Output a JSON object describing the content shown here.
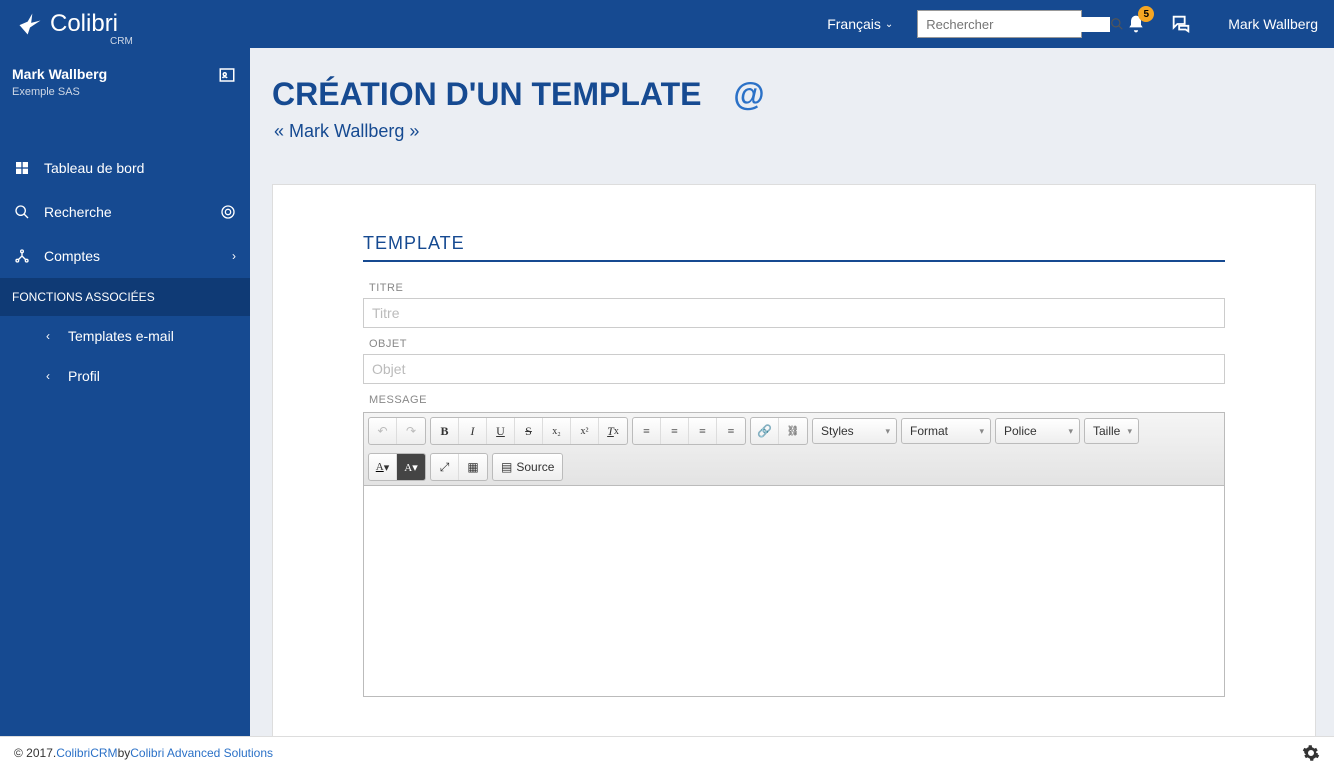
{
  "header": {
    "brand": "Colibri",
    "brand_sub": "CRM",
    "language": "Français",
    "search_placeholder": "Rechercher",
    "badge_count": "5",
    "user_name": "Mark Wallberg"
  },
  "sidebar": {
    "user_name": "Mark Wallberg",
    "user_company": "Exemple SAS",
    "items": [
      {
        "label": "Tableau de bord"
      },
      {
        "label": "Recherche"
      },
      {
        "label": "Comptes"
      }
    ],
    "associated_header": "FONCTIONS ASSOCIÉES",
    "sub_items": [
      {
        "label": "Templates e-mail"
      },
      {
        "label": "Profil"
      }
    ]
  },
  "page": {
    "title": "CRÉATION D'UN TEMPLATE",
    "at": "@",
    "breadcrumb": "« Mark Wallberg »",
    "section": "TEMPLATE",
    "field_titre_label": "TITRE",
    "field_titre_placeholder": "Titre",
    "field_objet_label": "OBJET",
    "field_objet_placeholder": "Objet",
    "field_message_label": "MESSAGE"
  },
  "editor": {
    "styles": "Styles",
    "format": "Format",
    "font": "Police",
    "size": "Taille",
    "source": "Source"
  },
  "footer": {
    "copyright": "© 2017. ",
    "link1": "ColibriCRM",
    "by": " by ",
    "link2": "Colibri Advanced Solutions"
  }
}
